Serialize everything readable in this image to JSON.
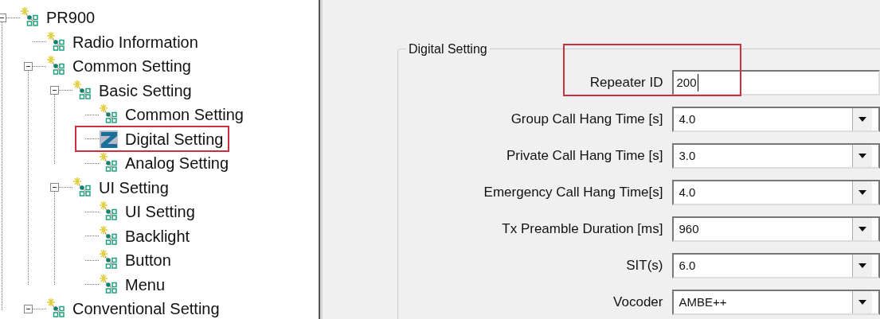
{
  "tree": [
    {
      "label": "PR900",
      "kind": "node",
      "expanded": true,
      "highlighted": false,
      "children": [
        {
          "label": "Radio Information",
          "kind": "node",
          "highlighted": false
        },
        {
          "label": "Common Setting",
          "kind": "node",
          "expanded": true,
          "highlighted": false,
          "children": [
            {
              "label": "Basic Setting",
              "kind": "node",
              "expanded": true,
              "highlighted": false,
              "children": [
                {
                  "label": "Common Setting",
                  "kind": "node",
                  "highlighted": false
                },
                {
                  "label": "Digital Setting",
                  "kind": "z-logo",
                  "highlighted": true
                },
                {
                  "label": "Analog Setting",
                  "kind": "node",
                  "highlighted": false
                }
              ]
            },
            {
              "label": "UI Setting",
              "kind": "node",
              "expanded": true,
              "highlighted": false,
              "children": [
                {
                  "label": "UI Setting",
                  "kind": "node",
                  "highlighted": false
                },
                {
                  "label": "Backlight",
                  "kind": "node",
                  "highlighted": false
                },
                {
                  "label": "Button",
                  "kind": "node",
                  "highlighted": false
                },
                {
                  "label": "Menu",
                  "kind": "node",
                  "highlighted": false
                }
              ]
            }
          ]
        },
        {
          "label": "Conventional Setting",
          "kind": "node",
          "expanded": true,
          "highlighted": false
        }
      ]
    }
  ],
  "group": {
    "title": "Digital Setting",
    "fields": [
      {
        "label": "Repeater ID",
        "kind": "text",
        "value": "200",
        "highlighted": true
      },
      {
        "label": "Group Call Hang Time [s]",
        "kind": "dropdown",
        "value": "4.0",
        "highlighted": false
      },
      {
        "label": "Private Call Hang Time [s]",
        "kind": "dropdown",
        "value": "3.0",
        "highlighted": false
      },
      {
        "label": "Emergency Call Hang Time[s]",
        "kind": "dropdown",
        "value": "4.0",
        "highlighted": false
      },
      {
        "label": "Tx Preamble Duration [ms]",
        "kind": "dropdown",
        "value": "960",
        "highlighted": false
      },
      {
        "label": "SIT(s)",
        "kind": "dropdown",
        "value": "6.0",
        "highlighted": false
      },
      {
        "label": "Vocoder",
        "kind": "dropdown",
        "value": "AMBE++",
        "highlighted": false
      }
    ]
  }
}
